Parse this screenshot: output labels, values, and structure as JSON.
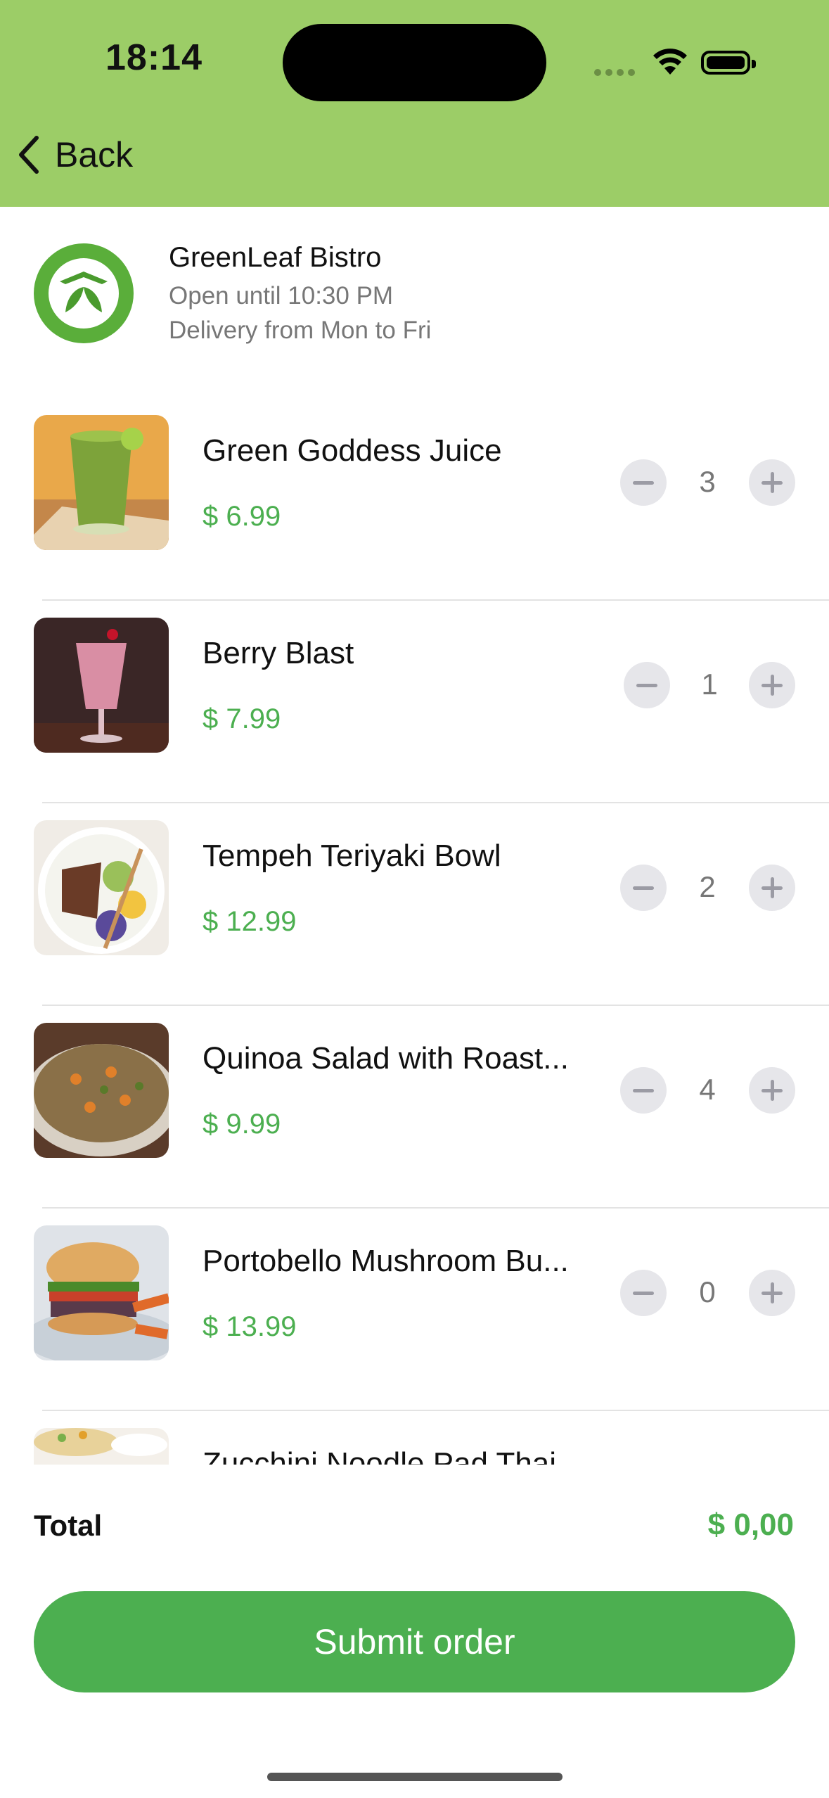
{
  "status_bar": {
    "time": "18:14"
  },
  "nav": {
    "back_label": "Back"
  },
  "restaurant": {
    "name": "GreenLeaf Bistro",
    "hours": "Open until 10:30 PM",
    "delivery": "Delivery from Mon to Fri"
  },
  "items": [
    {
      "name": "Green Goddess Juice",
      "price": "$ 6.99",
      "qty": "3"
    },
    {
      "name": "Berry Blast",
      "price": "$ 7.99",
      "qty": "1"
    },
    {
      "name": "Tempeh Teriyaki Bowl",
      "price": "$ 12.99",
      "qty": "2"
    },
    {
      "name": "Quinoa Salad with Roast...",
      "price": "$ 9.99",
      "qty": "4"
    },
    {
      "name": "Portobello Mushroom Bu...",
      "price": "$ 13.99",
      "qty": "0"
    },
    {
      "name": "Zucchini Noodle Pad Thai",
      "price": "",
      "qty": ""
    }
  ],
  "footer": {
    "total_label": "Total",
    "total_value": "$ 0,00",
    "submit_label": "Submit order"
  },
  "colors": {
    "header": "#9ccd67",
    "accent": "#4caf50"
  }
}
